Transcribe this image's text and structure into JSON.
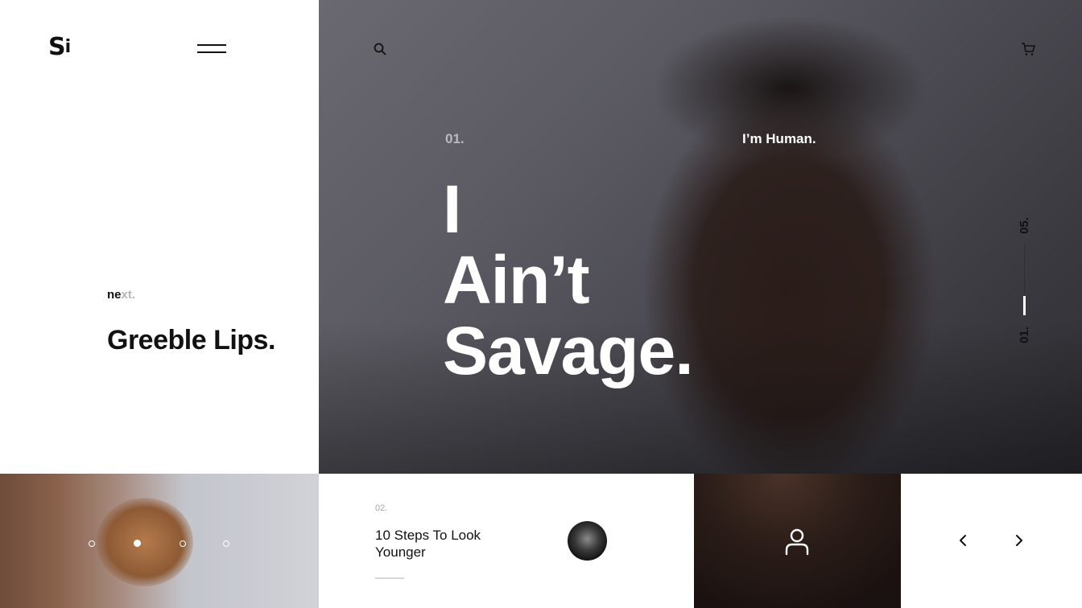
{
  "brand": {
    "logo_text": "S",
    "logo_dot": "i"
  },
  "header": {
    "menu_icon": "hamburger-icon",
    "search_icon": "search-icon",
    "cart_icon": "cart-icon"
  },
  "next_section": {
    "label_bold": "ne",
    "label_light": "xt.",
    "title": "Greeble Lips."
  },
  "hero": {
    "slide_number": "01.",
    "tag": "I’m Human.",
    "headline_lines": [
      "I",
      "Ain’t",
      "Savage."
    ],
    "counter_total": "05.",
    "counter_current": "01.",
    "progress": 0.2
  },
  "carousel": {
    "dot_count": 4,
    "active_index": 1
  },
  "article": {
    "number": "02.",
    "title": "10 Steps To Look Younger",
    "avatar_icon": "author-avatar"
  },
  "profile": {
    "icon": "user-icon"
  },
  "navigation": {
    "prev_icon": "chevron-left-icon",
    "next_icon": "chevron-right-icon"
  },
  "colors": {
    "text_dark": "#111111",
    "muted": "#b4b6be",
    "white": "#ffffff"
  }
}
